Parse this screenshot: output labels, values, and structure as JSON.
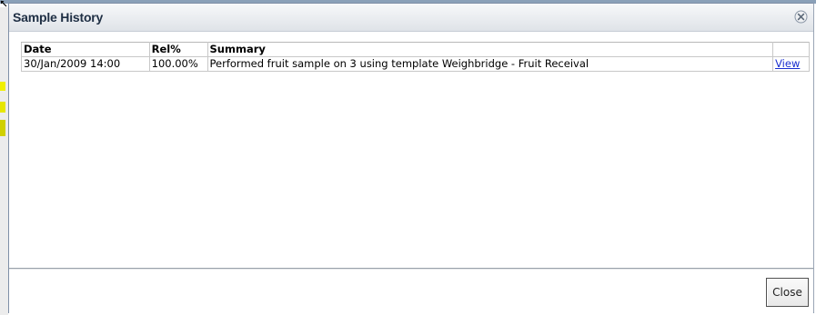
{
  "dialog": {
    "title": "Sample History",
    "close_icon": "close-circle-x-icon",
    "resize_icon": "resize-arrow-icon"
  },
  "table": {
    "columns": [
      "Date",
      "Rel%",
      "Summary",
      ""
    ],
    "rows": [
      {
        "date": "30/Jan/2009 14:00",
        "rel": "100.00%",
        "summary": "Performed fruit sample on 3 using template Weighbridge - Fruit Receival",
        "link": "View"
      }
    ]
  },
  "footer": {
    "close_label": "Close"
  },
  "colors": {
    "title_text": "#1f2f44",
    "link": "#1a2fd0",
    "titlebar_top": "#f7f8fa",
    "titlebar_bottom": "#dfe3e8"
  }
}
